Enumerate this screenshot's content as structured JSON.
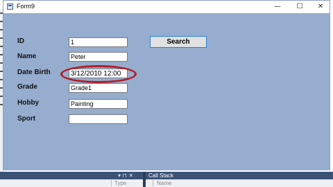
{
  "window": {
    "title": "Form9",
    "controls": {
      "minimize": "—",
      "maximize": "☐",
      "close": "✕"
    }
  },
  "form": {
    "labels": {
      "id": "ID",
      "name": "Name",
      "date_birth": "Date Birth",
      "grade": "Grade",
      "hobby": "Hobby",
      "sport": "Sport"
    },
    "values": {
      "id": "1",
      "name": "Peter",
      "date_birth": "3/12/2010 12:00",
      "grade": "Grade1",
      "hobby": "Painting",
      "sport": ""
    },
    "search_label": "Search"
  },
  "ide": {
    "left_panel": {
      "tools": "▾ ⊓ ✕",
      "column": "Type"
    },
    "right_panel": {
      "title": "Call Stack",
      "column": "Name"
    }
  },
  "colors": {
    "form_background": "#96adcf",
    "annotation": "#b51c25",
    "button_border": "#2d7fd3",
    "ide_header": "#3b5277"
  }
}
